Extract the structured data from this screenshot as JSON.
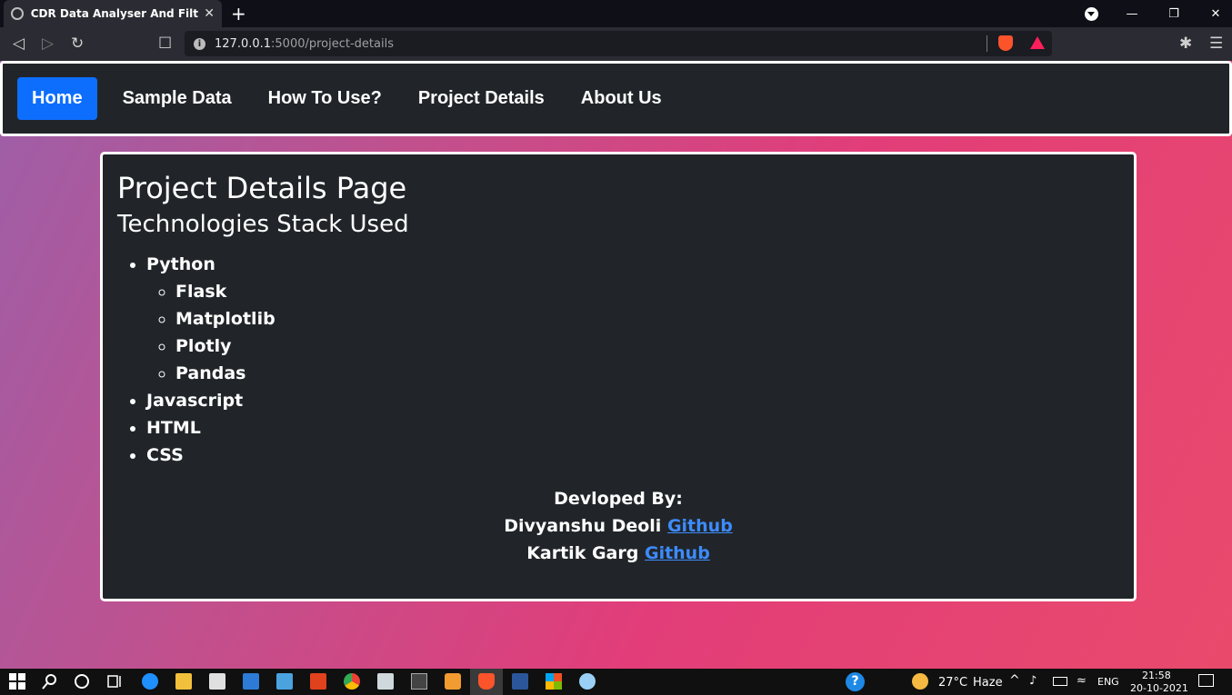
{
  "browser": {
    "tab_title": "CDR Data Analyser And Filteration",
    "url_host": "127.0.0.1",
    "url_path": ":5000/project-details"
  },
  "nav": {
    "items": [
      {
        "label": "Home",
        "active": true
      },
      {
        "label": "Sample Data"
      },
      {
        "label": "How To Use?"
      },
      {
        "label": "Project Details"
      },
      {
        "label": "About Us"
      }
    ]
  },
  "content": {
    "title": "Project Details Page",
    "subtitle": "Technologies Stack Used",
    "tech": {
      "python": "Python",
      "python_libs": [
        "Flask",
        "Matplotlib",
        "Plotly",
        "Pandas"
      ],
      "others": [
        "Javascript",
        "HTML",
        "CSS"
      ]
    },
    "credits": {
      "heading": "Devloped By:",
      "dev1_name": "Divyanshu Deoli",
      "dev1_link": "Github",
      "dev2_name": "Kartik Garg",
      "dev2_link": "Github"
    }
  },
  "taskbar": {
    "weather_temp": "27°C",
    "weather_desc": "Haze",
    "lang": "ENG",
    "time": "21:58",
    "date": "20-10-2021"
  },
  "colors": {
    "accent": "#0d6efd",
    "card_bg": "#212529",
    "link": "#3d8bfd"
  }
}
